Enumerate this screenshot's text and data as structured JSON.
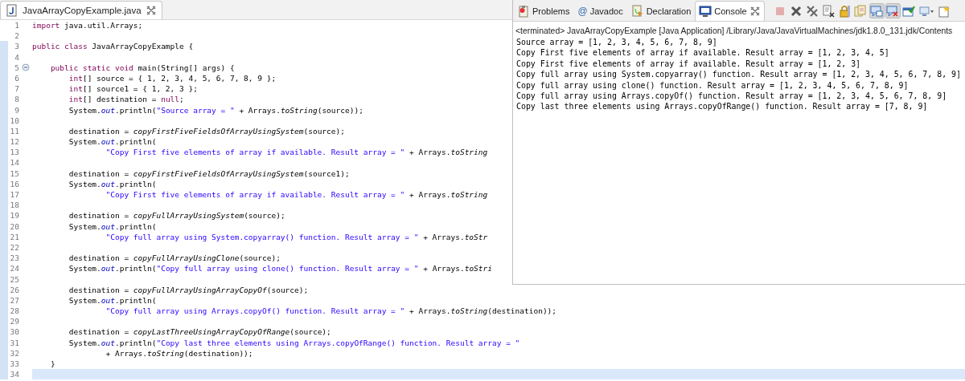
{
  "editor": {
    "tab": {
      "title": "JavaArrayCopyExample.java",
      "selected": true
    },
    "lines": [
      {
        "number": "1",
        "marked": false,
        "current": false,
        "segments": [
          {
            "kind": "keyword",
            "text": "import"
          },
          {
            "kind": "plain",
            "text": " java.util.Arrays;"
          }
        ]
      },
      {
        "number": "2",
        "marked": false,
        "current": false
      },
      {
        "number": "3",
        "marked": true,
        "current": false,
        "segments": [
          {
            "kind": "keyword",
            "text": "public class"
          },
          {
            "kind": "plain",
            "text": " JavaArrayCopyExample {"
          }
        ]
      },
      {
        "number": "4",
        "marked": true,
        "current": false
      },
      {
        "number": "5",
        "marked": true,
        "current": false,
        "collapsed": false,
        "segments": [
          {
            "kind": "keyword",
            "text": "    public static void"
          },
          {
            "kind": "plain",
            "text": " main(String[] args) {"
          }
        ]
      },
      {
        "number": "6",
        "marked": true,
        "current": false,
        "segments": [
          {
            "kind": "keyword",
            "text": "        int"
          },
          {
            "kind": "plain",
            "text": "[] source = { 1, 2, 3, 4, 5, 6, 7, 8, 9 };"
          }
        ]
      },
      {
        "number": "7",
        "marked": true,
        "current": false,
        "segments": [
          {
            "kind": "keyword",
            "text": "        int"
          },
          {
            "kind": "plain",
            "text": "[] source1 = { 1, 2, 3 };"
          }
        ]
      },
      {
        "number": "8",
        "marked": true,
        "current": false,
        "segments": [
          {
            "kind": "keyword",
            "text": "        int"
          },
          {
            "kind": "plain",
            "text": "[] destination = "
          },
          {
            "kind": "keyword",
            "text": "null"
          },
          {
            "kind": "plain",
            "text": ";"
          }
        ]
      },
      {
        "number": "9",
        "marked": true,
        "current": false,
        "segments": [
          {
            "kind": "plain",
            "text": "        System."
          },
          {
            "kind": "field",
            "text": "out"
          },
          {
            "kind": "plain",
            "text": ".println("
          },
          {
            "kind": "string",
            "text": "\"Source array = \""
          },
          {
            "kind": "plain",
            "text": " + Arrays."
          },
          {
            "kind": "static",
            "text": "toString"
          },
          {
            "kind": "plain",
            "text": "(source));"
          }
        ]
      },
      {
        "number": "10",
        "marked": true,
        "current": false
      },
      {
        "number": "11",
        "marked": true,
        "current": false,
        "segments": [
          {
            "kind": "plain",
            "text": "        destination = "
          },
          {
            "kind": "static",
            "text": "copyFirstFiveFieldsOfArrayUsingSystem"
          },
          {
            "kind": "plain",
            "text": "(source);"
          }
        ]
      },
      {
        "number": "12",
        "marked": true,
        "current": false,
        "segments": [
          {
            "kind": "plain",
            "text": "        System."
          },
          {
            "kind": "field",
            "text": "out"
          },
          {
            "kind": "plain",
            "text": ".println("
          }
        ]
      },
      {
        "number": "13",
        "marked": true,
        "current": false,
        "segments": [
          {
            "kind": "string",
            "text": "                \"Copy First five elements of array if available. Result array = \""
          },
          {
            "kind": "plain",
            "text": " + Arrays."
          },
          {
            "kind": "static",
            "text": "toString"
          }
        ]
      },
      {
        "number": "14",
        "marked": true,
        "current": false
      },
      {
        "number": "15",
        "marked": true,
        "current": false,
        "segments": [
          {
            "kind": "plain",
            "text": "        destination = "
          },
          {
            "kind": "static",
            "text": "copyFirstFiveFieldsOfArrayUsingSystem"
          },
          {
            "kind": "plain",
            "text": "(source1);"
          }
        ]
      },
      {
        "number": "16",
        "marked": true,
        "current": false,
        "segments": [
          {
            "kind": "plain",
            "text": "        System."
          },
          {
            "kind": "field",
            "text": "out"
          },
          {
            "kind": "plain",
            "text": ".println("
          }
        ]
      },
      {
        "number": "17",
        "marked": true,
        "current": false,
        "segments": [
          {
            "kind": "string",
            "text": "                \"Copy First five elements of array if available. Result array = \""
          },
          {
            "kind": "plain",
            "text": " + Arrays."
          },
          {
            "kind": "static",
            "text": "toString"
          }
        ]
      },
      {
        "number": "18",
        "marked": true,
        "current": false
      },
      {
        "number": "19",
        "marked": true,
        "current": false,
        "segments": [
          {
            "kind": "plain",
            "text": "        destination = "
          },
          {
            "kind": "static",
            "text": "copyFullArrayUsingSystem"
          },
          {
            "kind": "plain",
            "text": "(source);"
          }
        ]
      },
      {
        "number": "20",
        "marked": true,
        "current": false,
        "segments": [
          {
            "kind": "plain",
            "text": "        System."
          },
          {
            "kind": "field",
            "text": "out"
          },
          {
            "kind": "plain",
            "text": ".println("
          }
        ]
      },
      {
        "number": "21",
        "marked": true,
        "current": false,
        "segments": [
          {
            "kind": "string",
            "text": "                \"Copy full array using System.copyarray() function. Result array = \""
          },
          {
            "kind": "plain",
            "text": " + Arrays."
          },
          {
            "kind": "static",
            "text": "toStr"
          }
        ]
      },
      {
        "number": "22",
        "marked": true,
        "current": false
      },
      {
        "number": "23",
        "marked": true,
        "current": false,
        "segments": [
          {
            "kind": "plain",
            "text": "        destination = "
          },
          {
            "kind": "static",
            "text": "copyFullArrayUsingClone"
          },
          {
            "kind": "plain",
            "text": "(source);"
          }
        ]
      },
      {
        "number": "24",
        "marked": true,
        "current": false,
        "segments": [
          {
            "kind": "plain",
            "text": "        System."
          },
          {
            "kind": "field",
            "text": "out"
          },
          {
            "kind": "plain",
            "text": ".println("
          },
          {
            "kind": "string",
            "text": "\"Copy full array using clone() function. Result array = \""
          },
          {
            "kind": "plain",
            "text": " + Arrays."
          },
          {
            "kind": "static",
            "text": "toStri"
          }
        ]
      },
      {
        "number": "25",
        "marked": true,
        "current": false
      },
      {
        "number": "26",
        "marked": true,
        "current": false,
        "segments": [
          {
            "kind": "plain",
            "text": "        destination = "
          },
          {
            "kind": "static",
            "text": "copyFullArrayUsingArrayCopyOf"
          },
          {
            "kind": "plain",
            "text": "(source);"
          }
        ]
      },
      {
        "number": "27",
        "marked": true,
        "current": false,
        "segments": [
          {
            "kind": "plain",
            "text": "        System."
          },
          {
            "kind": "field",
            "text": "out"
          },
          {
            "kind": "plain",
            "text": ".println("
          }
        ]
      },
      {
        "number": "28",
        "marked": true,
        "current": false,
        "segments": [
          {
            "kind": "string",
            "text": "                \"Copy full array using Arrays.copyOf() function. Result array = \""
          },
          {
            "kind": "plain",
            "text": " + Arrays."
          },
          {
            "kind": "static",
            "text": "toString"
          },
          {
            "kind": "plain",
            "text": "(destination));"
          }
        ]
      },
      {
        "number": "29",
        "marked": true,
        "current": false
      },
      {
        "number": "30",
        "marked": true,
        "current": false,
        "segments": [
          {
            "kind": "plain",
            "text": "        destination = "
          },
          {
            "kind": "static",
            "text": "copyLastThreeUsingArrayCopyOfRange"
          },
          {
            "kind": "plain",
            "text": "(source);"
          }
        ]
      },
      {
        "number": "31",
        "marked": true,
        "current": false,
        "segments": [
          {
            "kind": "plain",
            "text": "        System."
          },
          {
            "kind": "field",
            "text": "out"
          },
          {
            "kind": "plain",
            "text": ".println("
          },
          {
            "kind": "string",
            "text": "\"Copy last three elements using Arrays.copyOfRange() function. Result array = \""
          }
        ]
      },
      {
        "number": "32",
        "marked": true,
        "current": false,
        "segments": [
          {
            "kind": "plain",
            "text": "                + Arrays."
          },
          {
            "kind": "static",
            "text": "toString"
          },
          {
            "kind": "plain",
            "text": "(destination));"
          }
        ]
      },
      {
        "number": "33",
        "marked": true,
        "current": false,
        "segments": [
          {
            "kind": "plain",
            "text": "    }"
          }
        ]
      },
      {
        "number": "34",
        "marked": true,
        "current": true
      }
    ]
  },
  "console": {
    "tabs": [
      {
        "label": "Problems",
        "kind": "problems",
        "selected": false
      },
      {
        "label": "Javadoc",
        "kind": "javadoc",
        "glyph": "@",
        "selected": false
      },
      {
        "label": "Declaration",
        "kind": "declaration",
        "selected": false
      },
      {
        "label": "Console",
        "kind": "console",
        "selected": true
      }
    ],
    "toolbar": [
      {
        "kind": "stop",
        "disabled": true,
        "pressed": false
      },
      {
        "kind": "remove",
        "disabled": false,
        "pressed": false
      },
      {
        "kind": "removeall",
        "disabled": false,
        "pressed": false
      },
      {
        "kind": "clear",
        "disabled": false,
        "pressed": false
      },
      {
        "kind": "lock",
        "disabled": false,
        "pressed": false
      },
      {
        "kind": "wrap",
        "disabled": false,
        "pressed": false
      },
      {
        "kind": "stdout",
        "disabled": false,
        "pressed": true
      },
      {
        "kind": "stderr",
        "disabled": false,
        "pressed": true
      },
      {
        "kind": "pin",
        "disabled": false,
        "pressed": false
      },
      {
        "kind": "display",
        "disabled": false,
        "pressed": false
      },
      {
        "kind": "open",
        "disabled": false,
        "pressed": false
      }
    ],
    "process_label": "<terminated> JavaArrayCopyExample [Java Application] /Library/Java/JavaVirtualMachines/jdk1.8.0_131.jdk/Contents",
    "output": [
      "Source array = [1, 2, 3, 4, 5, 6, 7, 8, 9]",
      "Copy First five elements of array if available. Result array = [1, 2, 3, 4, 5]",
      "Copy First five elements of array if available. Result array = [1, 2, 3]",
      "Copy full array using System.copyarray() function. Result array = [1, 2, 3, 4, 5, 6, 7, 8, 9]",
      "Copy full array using clone() function. Result array = [1, 2, 3, 4, 5, 6, 7, 8, 9]",
      "Copy full array using Arrays.copyOf() function. Result array = [1, 2, 3, 4, 5, 6, 7, 8, 9]",
      "Copy last three elements using Arrays.copyOfRange() function. Result array = [7, 8, 9]"
    ]
  }
}
